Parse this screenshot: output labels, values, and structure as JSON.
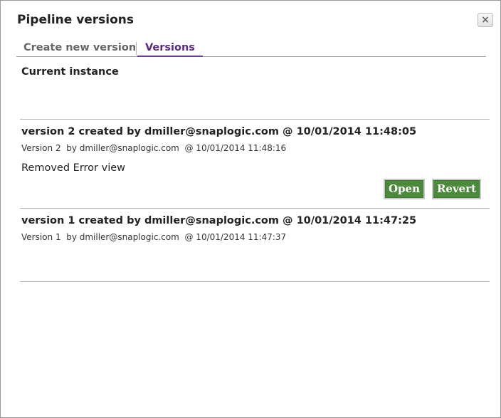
{
  "dialog": {
    "title": "Pipeline versions",
    "close_label": "×"
  },
  "tabs": [
    {
      "label": "Create new version"
    },
    {
      "label": "Versions"
    }
  ],
  "current_instance_label": "Current instance",
  "versions": [
    {
      "title": "version 2 created by dmiller@snaplogic.com @ 10/01/2014 11:48:05",
      "subtitle": "Version 2  by dmiller@snaplogic.com  @ 10/01/2014 11:48:16",
      "message": "Removed Error view",
      "open_label": "Open",
      "revert_label": "Revert"
    },
    {
      "title": "version 1 created by dmiller@snaplogic.com @ 10/01/2014 11:47:25",
      "subtitle": "Version 1  by dmiller@snaplogic.com  @ 10/01/2014 11:47:37"
    }
  ],
  "colors": {
    "accent_purple": "#5b2a86",
    "button_green": "#4a8a3a"
  }
}
